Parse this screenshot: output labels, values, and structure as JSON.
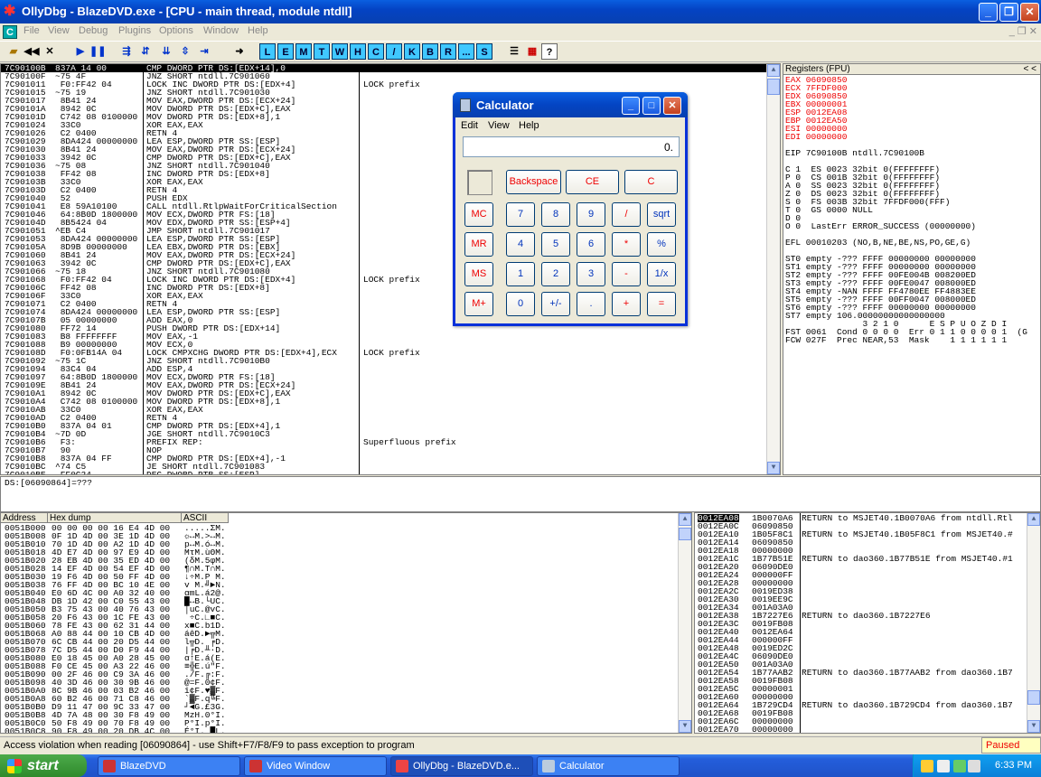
{
  "window": {
    "title": "OllyDbg - BlazeDVD.exe - [CPU - main thread, module ntdll]",
    "min": "_",
    "max": "❐",
    "close": "✕"
  },
  "menu": {
    "items": [
      "File",
      "View",
      "Debug",
      "Plugins",
      "Options",
      "Window",
      "Help"
    ],
    "mdi": "_ ❐ ✕"
  },
  "toolbar": {
    "letters": [
      "L",
      "E",
      "M",
      "T",
      "W",
      "H",
      "C",
      "/",
      "K",
      "B",
      "R",
      "...",
      "S"
    ]
  },
  "cpu": {
    "rows": [
      {
        "addr": "7C90100B",
        "hex": "837A 14 00",
        "dis": "CMP DWORD PTR DS:[EDX+14],0",
        "com": ""
      },
      {
        "addr": "7C90100F",
        "hex": "~75 4F",
        "dis": "JNZ SHORT ntdll.7C901060",
        "com": ""
      },
      {
        "addr": "7C901011",
        "hex": " F0:FF42 04",
        "dis": "LOCK INC DWORD PTR DS:[EDX+4]",
        "com": "LOCK prefix"
      },
      {
        "addr": "7C901015",
        "hex": "~75 19",
        "dis": "JNZ SHORT ntdll.7C901030",
        "com": ""
      },
      {
        "addr": "7C901017",
        "hex": " 8B41 24",
        "dis": "MOV EAX,DWORD PTR DS:[ECX+24]",
        "com": ""
      },
      {
        "addr": "7C90101A",
        "hex": " 8942 0C",
        "dis": "MOV DWORD PTR DS:[EDX+C],EAX",
        "com": ""
      },
      {
        "addr": "7C90101D",
        "hex": " C742 08 0100000",
        "dis": "MOV DWORD PTR DS:[EDX+8],1",
        "com": ""
      },
      {
        "addr": "7C901024",
        "hex": " 33C0",
        "dis": "XOR EAX,EAX",
        "com": ""
      },
      {
        "addr": "7C901026",
        "hex": " C2 0400",
        "dis": "RETN 4",
        "com": ""
      },
      {
        "addr": "7C901029",
        "hex": " 8DA424 00000000",
        "dis": "LEA ESP,DWORD PTR SS:[ESP]",
        "com": ""
      },
      {
        "addr": "7C901030",
        "hex": " 8B41 24",
        "dis": "MOV EAX,DWORD PTR DS:[ECX+24]",
        "com": ""
      },
      {
        "addr": "7C901033",
        "hex": " 3942 0C",
        "dis": "CMP DWORD PTR DS:[EDX+C],EAX",
        "com": ""
      },
      {
        "addr": "7C901036",
        "hex": "~75 08",
        "dis": "JNZ SHORT ntdll.7C901040",
        "com": ""
      },
      {
        "addr": "7C901038",
        "hex": " FF42 08",
        "dis": "INC DWORD PTR DS:[EDX+8]",
        "com": ""
      },
      {
        "addr": "7C90103B",
        "hex": " 33C0",
        "dis": "XOR EAX,EAX",
        "com": ""
      },
      {
        "addr": "7C90103D",
        "hex": " C2 0400",
        "dis": "RETN 4",
        "com": ""
      },
      {
        "addr": "7C901040",
        "hex": " 52",
        "dis": "PUSH EDX",
        "com": ""
      },
      {
        "addr": "7C901041",
        "hex": " E8 59A10100",
        "dis": "CALL ntdll.RtlpWaitForCriticalSection",
        "com": ""
      },
      {
        "addr": "7C901046",
        "hex": " 64:8B0D 1800000",
        "dis": "MOV ECX,DWORD PTR FS:[18]",
        "com": ""
      },
      {
        "addr": "7C90104D",
        "hex": " 8B5424 04",
        "dis": "MOV EDX,DWORD PTR SS:[ESP+4]",
        "com": ""
      },
      {
        "addr": "7C901051",
        "hex": "^EB C4",
        "dis": "JMP SHORT ntdll.7C901017",
        "com": ""
      },
      {
        "addr": "7C901053",
        "hex": " 8DA424 00000000",
        "dis": "LEA ESP,DWORD PTR SS:[ESP]",
        "com": ""
      },
      {
        "addr": "7C90105A",
        "hex": " 8D9B 00000000",
        "dis": "LEA EBX,DWORD PTR DS:[EBX]",
        "com": ""
      },
      {
        "addr": "7C901060",
        "hex": " 8B41 24",
        "dis": "MOV EAX,DWORD PTR DS:[ECX+24]",
        "com": ""
      },
      {
        "addr": "7C901063",
        "hex": " 3942 0C",
        "dis": "CMP DWORD PTR DS:[EDX+C],EAX",
        "com": ""
      },
      {
        "addr": "7C901066",
        "hex": "~75 18",
        "dis": "JNZ SHORT ntdll.7C901080",
        "com": ""
      },
      {
        "addr": "7C901068",
        "hex": " F0:FF42 04",
        "dis": "LOCK INC DWORD PTR DS:[EDX+4]",
        "com": "LOCK prefix"
      },
      {
        "addr": "7C90106C",
        "hex": " FF42 08",
        "dis": "INC DWORD PTR DS:[EDX+8]",
        "com": ""
      },
      {
        "addr": "7C90106F",
        "hex": " 33C0",
        "dis": "XOR EAX,EAX",
        "com": ""
      },
      {
        "addr": "7C901071",
        "hex": " C2 0400",
        "dis": "RETN 4",
        "com": ""
      },
      {
        "addr": "7C901074",
        "hex": " 8DA424 00000000",
        "dis": "LEA ESP,DWORD PTR SS:[ESP]",
        "com": ""
      },
      {
        "addr": "7C90107B",
        "hex": " 05 00000000",
        "dis": "ADD EAX,0",
        "com": ""
      },
      {
        "addr": "7C901080",
        "hex": " FF72 14",
        "dis": "PUSH DWORD PTR DS:[EDX+14]",
        "com": ""
      },
      {
        "addr": "7C901083",
        "hex": " B8 FFFFFFFF",
        "dis": "MOV EAX,-1",
        "com": ""
      },
      {
        "addr": "7C901088",
        "hex": " B9 00000000",
        "dis": "MOV ECX,0",
        "com": ""
      },
      {
        "addr": "7C90108D",
        "hex": " F0:0FB14A 04",
        "dis": "LOCK CMPXCHG DWORD PTR DS:[EDX+4],ECX",
        "com": "LOCK prefix"
      },
      {
        "addr": "7C901092",
        "hex": "~75 1C",
        "dis": "JNZ SHORT ntdll.7C9010B0",
        "com": ""
      },
      {
        "addr": "7C901094",
        "hex": " 83C4 04",
        "dis": "ADD ESP,4",
        "com": ""
      },
      {
        "addr": "7C901097",
        "hex": " 64:8B0D 1800000",
        "dis": "MOV ECX,DWORD PTR FS:[18]",
        "com": ""
      },
      {
        "addr": "7C90109E",
        "hex": " 8B41 24",
        "dis": "MOV EAX,DWORD PTR DS:[ECX+24]",
        "com": ""
      },
      {
        "addr": "7C9010A1",
        "hex": " 8942 0C",
        "dis": "MOV DWORD PTR DS:[EDX+C],EAX",
        "com": ""
      },
      {
        "addr": "7C9010A4",
        "hex": " C742 08 0100000",
        "dis": "MOV DWORD PTR DS:[EDX+8],1",
        "com": ""
      },
      {
        "addr": "7C9010AB",
        "hex": " 33C0",
        "dis": "XOR EAX,EAX",
        "com": ""
      },
      {
        "addr": "7C9010AD",
        "hex": " C2 0400",
        "dis": "RETN 4",
        "com": ""
      },
      {
        "addr": "7C9010B0",
        "hex": " 837A 04 01",
        "dis": "CMP DWORD PTR DS:[EDX+4],1",
        "com": ""
      },
      {
        "addr": "7C9010B4",
        "hex": "~7D 0D",
        "dis": "JGE SHORT ntdll.7C9010C3",
        "com": ""
      },
      {
        "addr": "7C9010B6",
        "hex": " F3:",
        "dis": "PREFIX REP:",
        "com": "Superfluous prefix"
      },
      {
        "addr": "7C9010B7",
        "hex": " 90",
        "dis": "NOP",
        "com": ""
      },
      {
        "addr": "7C9010B8",
        "hex": " 837A 04 FF",
        "dis": "CMP DWORD PTR DS:[EDX+4],-1",
        "com": ""
      },
      {
        "addr": "7C9010BC",
        "hex": "^74 C5",
        "dis": "JE SHORT ntdll.7C901083",
        "com": ""
      },
      {
        "addr": "7C9010BE",
        "hex": " FF0C24",
        "dis": "DEC DWORD PTR SS:[ESP]",
        "com": ""
      }
    ]
  },
  "registers": {
    "header": "Registers (FPU)",
    "nav": "<   <",
    "lines": [
      {
        "text": "EAX 06090850",
        "red": true
      },
      {
        "text": "ECX 7FFDF000",
        "red": true
      },
      {
        "text": "EDX 06090850",
        "red": true
      },
      {
        "text": "EBX 00000001",
        "red": true
      },
      {
        "text": "ESP 0012EA08",
        "red": true
      },
      {
        "text": "EBP 0012EA50",
        "red": true
      },
      {
        "text": "ESI 00000000",
        "red": true
      },
      {
        "text": "EDI 00000000",
        "red": true
      },
      {
        "text": "",
        "red": false
      },
      {
        "text": "EIP 7C90100B ntdll.7C90100B",
        "red": false
      },
      {
        "text": "",
        "red": false
      },
      {
        "text": "C 1  ES 0023 32bit 0(FFFFFFFF)",
        "red": false
      },
      {
        "text": "P 0  CS 001B 32bit 0(FFFFFFFF)",
        "red": false
      },
      {
        "text": "A 0  SS 0023 32bit 0(FFFFFFFF)",
        "red": false
      },
      {
        "text": "Z 0  DS 0023 32bit 0(FFFFFFFF)",
        "red": false
      },
      {
        "text": "S 0  FS 003B 32bit 7FFDF000(FFF)",
        "red": false
      },
      {
        "text": "T 0  GS 0000 NULL",
        "red": false
      },
      {
        "text": "D 0",
        "red": false
      },
      {
        "text": "O 0  LastErr ERROR_SUCCESS (00000000)",
        "red": false
      },
      {
        "text": "",
        "red": false
      },
      {
        "text": "EFL 00010203 (NO,B,NE,BE,NS,PO,GE,G)",
        "red": false
      },
      {
        "text": "",
        "red": false
      },
      {
        "text": "ST0 empty -??? FFFF 00000000 00000000",
        "red": false
      },
      {
        "text": "ST1 empty -??? FFFF 00000000 00000000",
        "red": false
      },
      {
        "text": "ST2 empty -??? FFFF 00FE004B 008200ED",
        "red": false
      },
      {
        "text": "ST3 empty -??? FFFF 00FE0047 008000ED",
        "red": false
      },
      {
        "text": "ST4 empty -NAN FFFF FF4780EE FF4883EE",
        "red": false
      },
      {
        "text": "ST5 empty -??? FFFF 00FF0047 008000ED",
        "red": false
      },
      {
        "text": "ST6 empty -??? FFFF 00000000 00000000",
        "red": false
      },
      {
        "text": "ST7 empty 106.00000000000000000",
        "red": false
      },
      {
        "text": "               3 2 1 0      E S P U O Z D I",
        "red": false
      },
      {
        "text": "FST 0061  Cond 0 0 0 0  Err 0 1 1 0 0 0 0 1  (G",
        "red": false
      },
      {
        "text": "FCW 027F  Prec NEAR,53  Mask    1 1 1 1 1 1",
        "red": false
      }
    ]
  },
  "info": {
    "text": "DS:[06090864]=???"
  },
  "dump": {
    "headers": [
      "Address",
      "Hex dump",
      "ASCII"
    ],
    "rows": [
      [
        "0051B000",
        "00 00 00 00 16 E4 4D 00",
        ".....ΣM."
      ],
      [
        "0051B008",
        "0F 1D 4D 00 3E 1D 4D 00",
        "☼↔M.>↔M."
      ],
      [
        "0051B010",
        "70 1D 4D 00 A2 1D 4D 00",
        "p↔M.ó↔M."
      ],
      [
        "0051B018",
        "4D E7 4D 00 97 E9 4D 00",
        "MτM.ùΘM."
      ],
      [
        "0051B020",
        "28 EB 4D 00 35 ED 4D 00",
        "(δM.5φM."
      ],
      [
        "0051B028",
        "14 EF 4D 00 54 EF 4D 00",
        "¶∩M.T∩M."
      ],
      [
        "0051B030",
        "19 F6 4D 00 50 FF 4D 00",
        "↓÷M.P M."
      ],
      [
        "0051B038",
        "76 FF 4D 00 BC 10 4E 00",
        "v M.╝►N."
      ],
      [
        "0051B040",
        "E0 6D 4C 00 A0 32 40 00",
        "αmL.á2@."
      ],
      [
        "0051B048",
        "DB 1D 42 00 C0 55 43 00",
        "█↔B.└UC."
      ],
      [
        "0051B050",
        "B3 75 43 00 40 76 43 00",
        "│uC.@vC."
      ],
      [
        "0051B058",
        "20 F6 43 00 1C FE 43 00",
        " ÷C.∟■C."
      ],
      [
        "0051B060",
        "78 FE 43 00 62 31 44 00",
        "x■C.b1D."
      ],
      [
        "0051B068",
        "A0 88 44 00 10 CB 4D 00",
        "áêD.►╦M."
      ],
      [
        "0051B070",
        "6C CB 44 00 20 D5 44 00",
        "l╦D. ╒D."
      ],
      [
        "0051B078",
        "7C D5 44 00 D0 F9 44 00",
        "|╒D.╨·D."
      ],
      [
        "0051B080",
        "E0 18 45 00 A0 28 45 00",
        "α↑E.á(E."
      ],
      [
        "0051B088",
        "F0 CE 45 00 A3 22 46 00",
        "≡╬E.ú\"F."
      ],
      [
        "0051B090",
        "00 2F 46 00 C9 3A 46 00",
        "./F.╔:F."
      ],
      [
        "0051B098",
        "40 3D 46 00 30 9B 46 00",
        "@=F.0¢F."
      ],
      [
        "0051B0A0",
        "8C 9B 46 00 03 B2 46 00",
        "î¢F.♥▓F."
      ],
      [
        "0051B0A8",
        "60 B2 46 00 71 C8 46 00",
        "`▓F.q╚F."
      ],
      [
        "0051B0B0",
        "D9 11 47 00 9C 33 47 00",
        "┘◄G.£3G."
      ],
      [
        "0051B0B8",
        "4D 7A 48 00 30 F8 49 00",
        "MzH.0°I."
      ],
      [
        "0051B0C0",
        "50 F8 49 00 70 F8 49 00",
        "P°I.p°I."
      ],
      [
        "0051B0C8",
        "90 F8 49 00 20 DB 4C 00",
        "É°I. █L."
      ]
    ]
  },
  "stack": {
    "rows": [
      [
        "0012EA08",
        "1B0070A6",
        "RETURN to MSJET40.1B0070A6 from ntdll.Rtl"
      ],
      [
        "0012EA0C",
        "06090850",
        ""
      ],
      [
        "0012EA10",
        "1B05F8C1",
        "RETURN to MSJET40.1B05F8C1 from MSJET40.#"
      ],
      [
        "0012EA14",
        "06090850",
        ""
      ],
      [
        "0012EA18",
        "00000000",
        ""
      ],
      [
        "0012EA1C",
        "1B77B51E",
        "RETURN to dao360.1B77B51E from MSJET40.#1"
      ],
      [
        "0012EA20",
        "06090DE0",
        ""
      ],
      [
        "0012EA24",
        "000000FF",
        ""
      ],
      [
        "0012EA28",
        "00000000",
        ""
      ],
      [
        "0012EA2C",
        "0019ED38",
        ""
      ],
      [
        "0012EA30",
        "0019EE9C",
        ""
      ],
      [
        "0012EA34",
        "001A03A0",
        ""
      ],
      [
        "0012EA38",
        "1B7227E6",
        "RETURN to dao360.1B7227E6"
      ],
      [
        "0012EA3C",
        "0019FB08",
        ""
      ],
      [
        "0012EA40",
        "0012EA64",
        ""
      ],
      [
        "0012EA44",
        "000000FF",
        ""
      ],
      [
        "0012EA48",
        "0019ED2C",
        ""
      ],
      [
        "0012EA4C",
        "06090DE0",
        ""
      ],
      [
        "0012EA50",
        "001A03A0",
        ""
      ],
      [
        "0012EA54",
        "1B77AAB2",
        "RETURN to dao360.1B77AAB2 from dao360.1B7"
      ],
      [
        "0012EA58",
        "0019FB08",
        ""
      ],
      [
        "0012EA5C",
        "00000001",
        ""
      ],
      [
        "0012EA60",
        "00000000",
        ""
      ],
      [
        "0012EA64",
        "1B729CD4",
        "RETURN to dao360.1B729CD4 from dao360.1B7"
      ],
      [
        "0012EA68",
        "0019FB08",
        ""
      ],
      [
        "0012EA6C",
        "00000000",
        ""
      ],
      [
        "0012EA70",
        "00000000",
        ""
      ]
    ]
  },
  "status": {
    "text": "Access violation when reading [06090864] - use Shift+F7/F8/F9 to pass exception to program",
    "state": "Paused"
  },
  "calculator": {
    "title": "Calculator",
    "min": "_",
    "max": "□",
    "close": "✕",
    "menu": [
      "Edit",
      "View",
      "Help"
    ],
    "display": "0.",
    "top": [
      "Backspace",
      "CE",
      "C"
    ],
    "mem": [
      "MC",
      "MR",
      "MS",
      "M+"
    ],
    "rows": [
      [
        "7",
        "8",
        "9",
        "/",
        "sqrt"
      ],
      [
        "4",
        "5",
        "6",
        "*",
        "%"
      ],
      [
        "1",
        "2",
        "3",
        "-",
        "1/x"
      ],
      [
        "0",
        "+/-",
        ".",
        "+",
        "="
      ]
    ]
  },
  "taskbar": {
    "start": "start",
    "tasks": [
      "BlazeDVD",
      "Video Window",
      "OllyDbg - BlazeDVD.e...",
      "Calculator"
    ],
    "clock": "6:33 PM"
  },
  "colors": {
    "titlebar": "#0A5FE0",
    "highlight": "#000000",
    "register_changed": "#E00000",
    "toolbar_letter": "#40C8FF"
  }
}
